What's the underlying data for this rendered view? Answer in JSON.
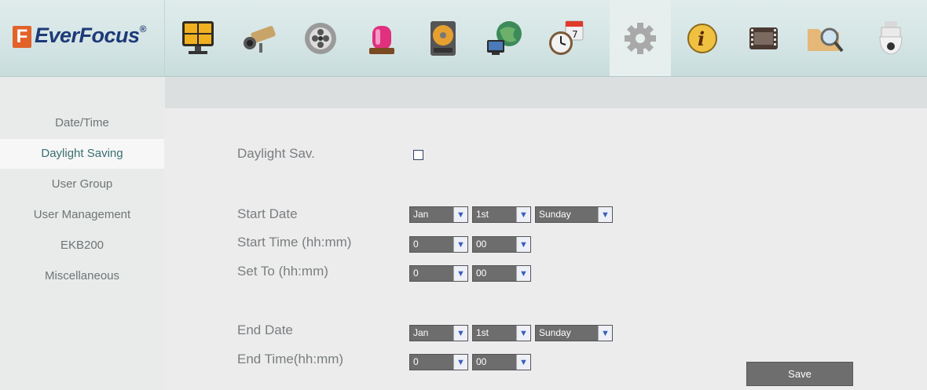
{
  "header": {
    "brand": "EverFocus",
    "brand_mark": "F",
    "brand_reg": "®",
    "tools": [
      {
        "icon": "monitor-grid-icon"
      },
      {
        "icon": "camera-icon"
      },
      {
        "icon": "film-reel-icon"
      },
      {
        "icon": "alarm-light-icon"
      },
      {
        "icon": "hard-disk-icon"
      },
      {
        "icon": "network-globe-icon"
      },
      {
        "icon": "schedule-clock-icon"
      },
      {
        "icon": "gear-icon"
      },
      {
        "icon": "info-icon"
      },
      {
        "icon": "video-strip-icon"
      },
      {
        "icon": "search-folder-icon"
      },
      {
        "icon": "ptz-dome-icon"
      }
    ],
    "active_tool": "gear-icon"
  },
  "sidebar": {
    "items": [
      {
        "label": "Date/Time"
      },
      {
        "label": "Daylight Saving"
      },
      {
        "label": "User Group"
      },
      {
        "label": "User Management"
      },
      {
        "label": "EKB200"
      },
      {
        "label": "Miscellaneous"
      }
    ],
    "active": "Daylight Saving"
  },
  "form": {
    "daylight_label": "Daylight Sav.",
    "daylight_checked": false,
    "start_date_label": "Start Date",
    "start_time_label": "Start Time (hh:mm)",
    "set_to_label": "Set To (hh:mm)",
    "end_date_label": "End Date",
    "end_time_label": "End Time(hh:mm)",
    "start_month": "Jan",
    "start_week": "1st",
    "start_day": "Sunday",
    "start_hour": "0",
    "start_min": "00",
    "set_hour": "0",
    "set_min": "00",
    "end_month": "Jan",
    "end_week": "1st",
    "end_day": "Sunday",
    "end_hour": "0",
    "end_min": "00",
    "save_label": "Save"
  },
  "colors": {
    "brand_orange": "#e2622a",
    "brand_blue": "#1d3a78",
    "accent_teal": "#3a6f72"
  }
}
